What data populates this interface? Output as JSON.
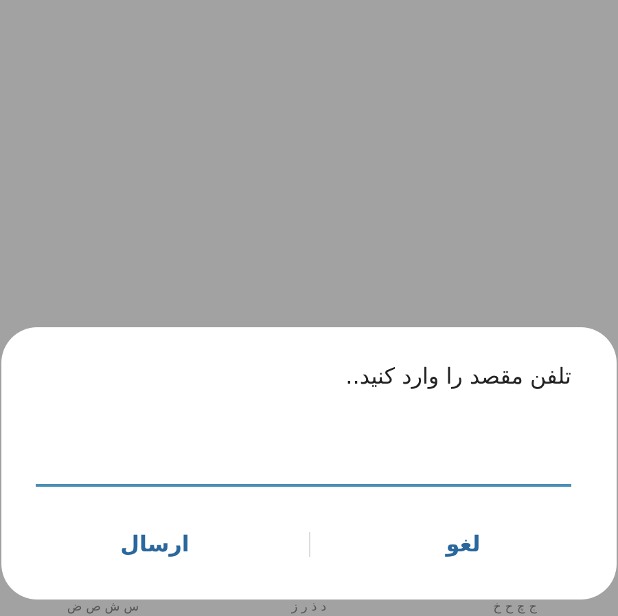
{
  "dialog": {
    "title": "تلفن مقصد را وارد کنید..",
    "field": {
      "focused": true
    },
    "buttons": [
      "لغو",
      "ارسال"
    ]
  },
  "keyboard_row": [
    "ج چ ح خ",
    "د ذ ر ز",
    "س ش ص ض"
  ]
}
